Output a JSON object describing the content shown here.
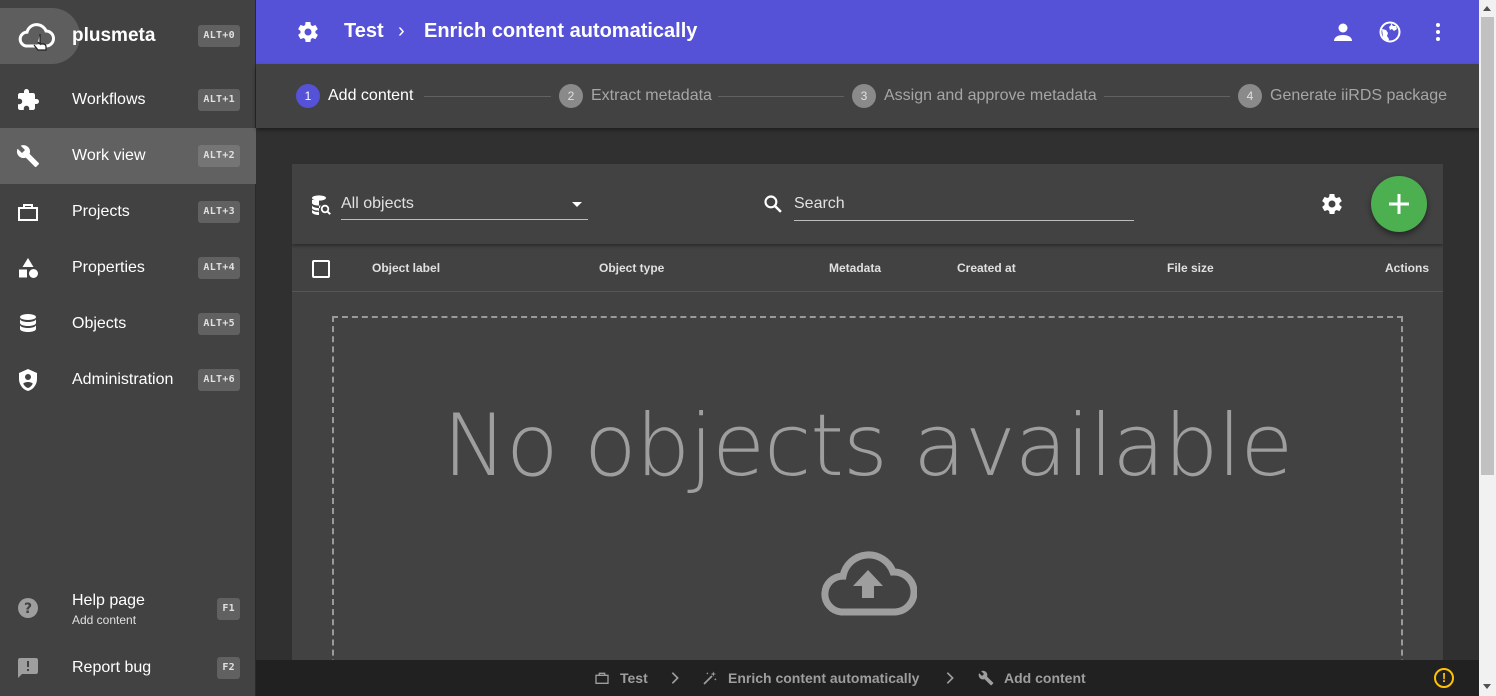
{
  "app": {
    "name": "plusmeta",
    "shortcut": "ALT+0"
  },
  "sidebar": {
    "items": [
      {
        "label": "Workflows",
        "shortcut": "ALT+1",
        "icon": "puzzle-icon"
      },
      {
        "label": "Work view",
        "shortcut": "ALT+2",
        "icon": "wrench-icon",
        "active": true
      },
      {
        "label": "Projects",
        "shortcut": "ALT+3",
        "icon": "briefcase-icon"
      },
      {
        "label": "Properties",
        "shortcut": "ALT+4",
        "icon": "shapes-icon"
      },
      {
        "label": "Objects",
        "shortcut": "ALT+5",
        "icon": "database-icon"
      },
      {
        "label": "Administration",
        "shortcut": "ALT+6",
        "icon": "shield-icon"
      }
    ],
    "help": {
      "label": "Help page",
      "sub": "Add content",
      "shortcut": "F1"
    },
    "report": {
      "label": "Report bug",
      "shortcut": "F2"
    }
  },
  "header": {
    "project": "Test",
    "separator": "›",
    "title": "Enrich content automatically"
  },
  "stepper": {
    "steps": [
      {
        "num": "1",
        "label": "Add content",
        "active": true
      },
      {
        "num": "2",
        "label": "Extract metadata"
      },
      {
        "num": "3",
        "label": "Assign and approve metadata"
      },
      {
        "num": "4",
        "label": "Generate iiRDS package"
      }
    ]
  },
  "toolbar": {
    "filter_value": "All objects",
    "search_placeholder": "Search"
  },
  "table": {
    "columns": [
      "Object label",
      "Object type",
      "Metadata",
      "Created at",
      "File size",
      "Actions"
    ]
  },
  "empty_state": {
    "message": "No objects available"
  },
  "statusbar": {
    "crumbs": [
      "Test",
      "Enrich content automatically",
      "Add content"
    ],
    "warning": "!"
  },
  "colors": {
    "accent": "#5552d8",
    "fab": "#4caf50",
    "warning": "#ffc107"
  }
}
